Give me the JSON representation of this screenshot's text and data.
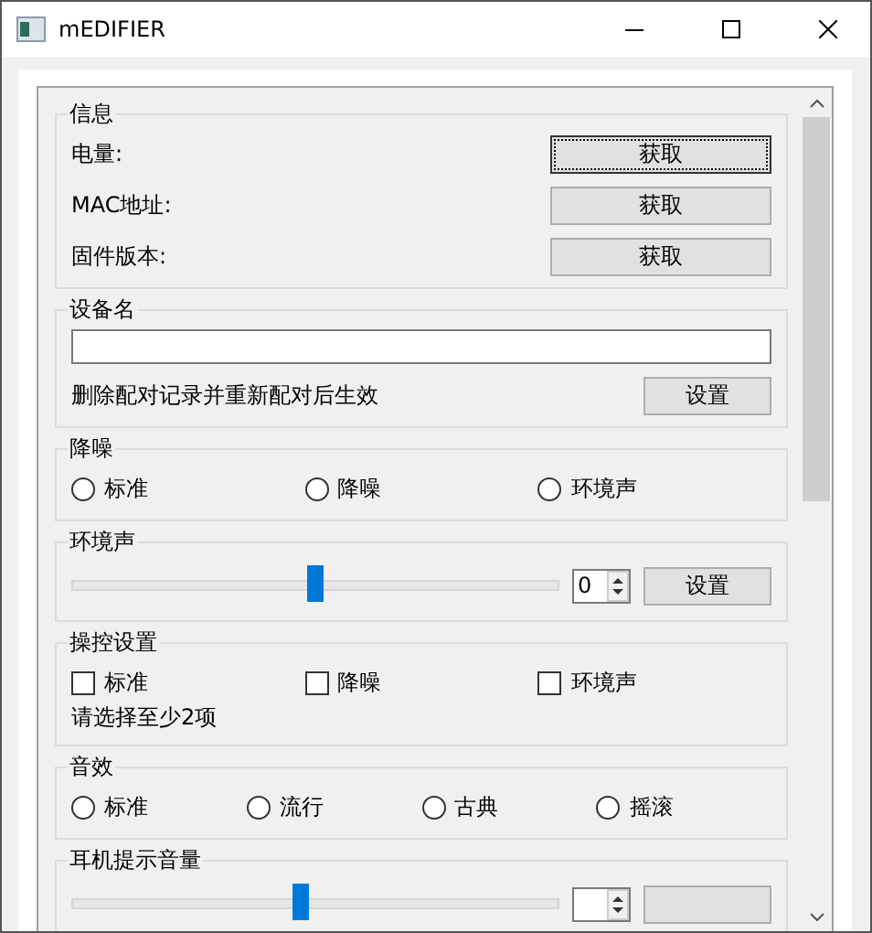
{
  "window": {
    "title": "mEDIFIER"
  },
  "groups": [
    {
      "kind": "info",
      "title": "信息",
      "rows": [
        {
          "label": "电量:",
          "button": "获取",
          "focused": true
        },
        {
          "label": "MAC地址:",
          "button": "获取",
          "focused": false
        },
        {
          "label": "固件版本:",
          "button": "获取",
          "focused": false
        }
      ]
    },
    {
      "kind": "name",
      "title": "设备名",
      "note": "删除配对记录并重新配对后生效",
      "button": "设置"
    },
    {
      "kind": "radios",
      "title": "降噪",
      "options": [
        {
          "label": "标准",
          "selected": false
        },
        {
          "label": "降噪",
          "selected": false
        },
        {
          "label": "环境声",
          "selected": false
        }
      ]
    },
    {
      "kind": "slider",
      "title": "环境声",
      "level": 0.5,
      "value": "0",
      "button": "设置"
    },
    {
      "kind": "checks",
      "title": "操控设置",
      "options": [
        {
          "label": "标准",
          "checked": false
        },
        {
          "label": "降噪",
          "checked": false
        },
        {
          "label": "环境声",
          "checked": false
        }
      ],
      "note": "请选择至少2项"
    },
    {
      "kind": "radios",
      "title": "音效",
      "options": [
        {
          "label": "标准",
          "selected": false
        },
        {
          "label": "流行",
          "selected": false
        },
        {
          "label": "古典",
          "selected": false
        },
        {
          "label": "摇滚",
          "selected": false
        }
      ]
    },
    {
      "kind": "slider",
      "title": "耳机提示音量",
      "level": 0.47
    }
  ]
}
